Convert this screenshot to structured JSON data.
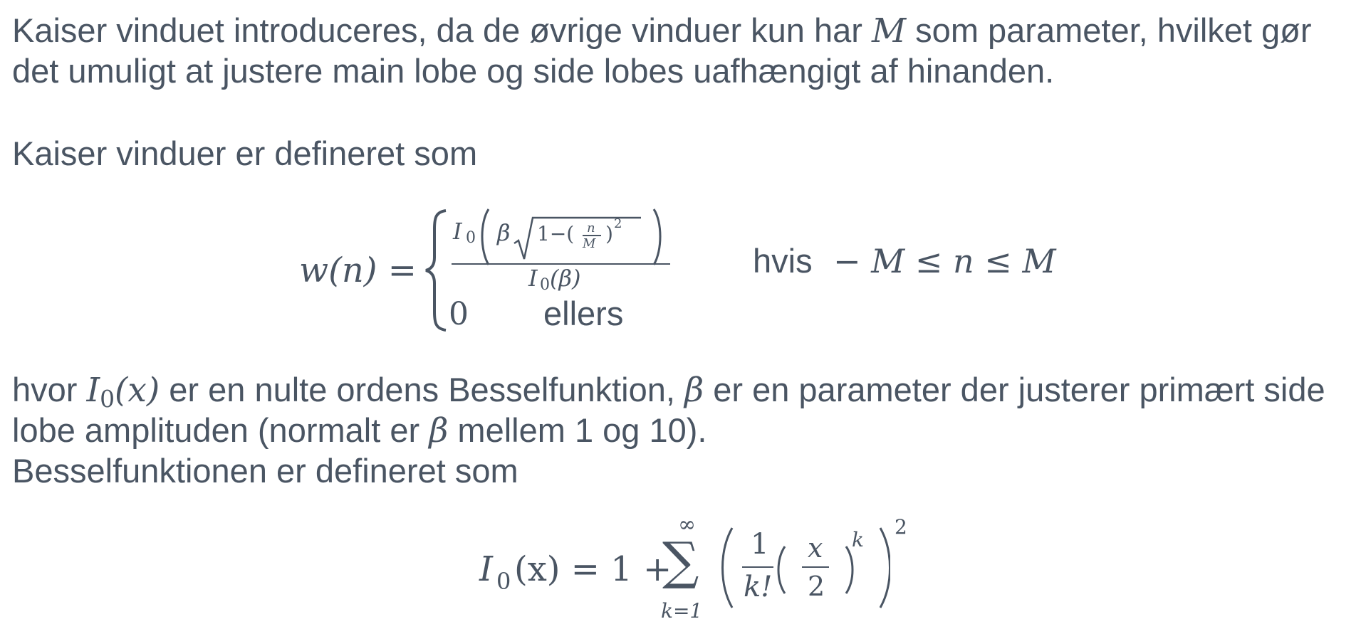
{
  "intro": {
    "line1_a": "Kaiser vinduet introduceres, da de øvrige vinduer kun har ",
    "line1_var": "M",
    "line1_b": " som parameter, hvilket gør",
    "line2": "det umuligt at justere main lobe og side lobes uafhængigt af hinanden."
  },
  "kaiser_def_heading": "Kaiser vinduer er defineret som",
  "kaiser_equation": {
    "lhs": "w(n) =",
    "case1_numerator_func": "I",
    "case1_numerator_sub": "0",
    "case1_numerator_beta": "β",
    "case1_numerator_root": "1−(",
    "case1_numerator_n": "n",
    "case1_numerator_M": "M",
    "case1_numerator_exp": "2",
    "case1_denominator": "I",
    "case1_denominator_sub": "0",
    "case1_denominator_arg": "(β)",
    "case1_condition_word": "hvis",
    "case1_condition_expr": "− M ≤ n ≤ M",
    "case2_value": "0",
    "case2_word": "ellers"
  },
  "bessel_text": {
    "line1_a": "hvor ",
    "line1_I": "I",
    "line1_sub": "0",
    "line1_x": "(x)",
    "line1_b": " er en nulte ordens Besselfunktion, ",
    "line1_beta": "β",
    "line1_c": " er en parameter der justerer primært side",
    "line2_a": "lobe amplituden (normalt er ",
    "line2_beta": "β",
    "line2_b": " mellem 1 og 10).",
    "line3": "Besselfunktionen er defineret som"
  },
  "bessel_equation": {
    "lhs_I": "I",
    "lhs_sub": "0",
    "lhs_arg": "(x) = 1 +",
    "sum_upper": "∞",
    "sum_symbol": "∑",
    "sum_lower": "k=1",
    "frac1_num": "1",
    "frac1_den": "k!",
    "frac2_num": "x",
    "frac2_den": "2",
    "inner_exp": "k",
    "outer_exp": "2"
  }
}
